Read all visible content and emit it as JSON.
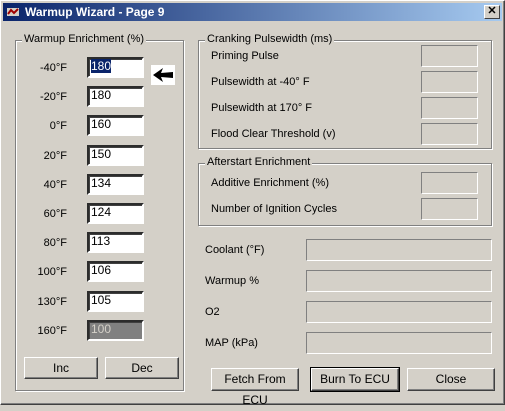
{
  "window": {
    "title": "Warmup Wizard - Page 9",
    "close_glyph": "✕"
  },
  "warmup": {
    "legend": "Warmup Enrichment (%)",
    "rows": [
      {
        "label": "-40°F",
        "value": "180"
      },
      {
        "label": "-20°F",
        "value": "180"
      },
      {
        "label": "0°F",
        "value": "160"
      },
      {
        "label": "20°F",
        "value": "150"
      },
      {
        "label": "40°F",
        "value": "134"
      },
      {
        "label": "60°F",
        "value": "124"
      },
      {
        "label": "80°F",
        "value": "113"
      },
      {
        "label": "100°F",
        "value": "106"
      },
      {
        "label": "130°F",
        "value": "105"
      },
      {
        "label": "160°F",
        "value": "100"
      }
    ],
    "inc_label": "Inc",
    "dec_label": "Dec",
    "pointer_icon": "arrow-left-icon"
  },
  "cranking": {
    "legend": "Cranking Pulsewidth (ms)",
    "rows": [
      "Priming Pulse",
      "Pulsewidth at -40° F",
      "Pulsewidth at  170° F",
      "Flood Clear Threshold (v)"
    ]
  },
  "afterstart": {
    "legend": "Afterstart Enrichment",
    "rows": [
      "Additive Enrichment (%)",
      "Number of Ignition Cycles"
    ]
  },
  "readouts": [
    "Coolant (°F)",
    "Warmup %",
    "O2",
    "MAP (kPa)"
  ],
  "buttons": {
    "fetch": "Fetch From ECU",
    "burn": "Burn To ECU",
    "close": "Close"
  }
}
